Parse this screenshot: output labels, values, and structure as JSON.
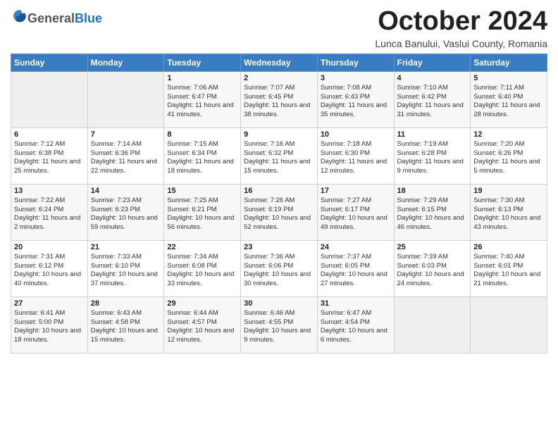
{
  "header": {
    "logo_general": "General",
    "logo_blue": "Blue",
    "month": "October 2024",
    "location": "Lunca Banului, Vaslui County, Romania"
  },
  "days_of_week": [
    "Sunday",
    "Monday",
    "Tuesday",
    "Wednesday",
    "Thursday",
    "Friday",
    "Saturday"
  ],
  "weeks": [
    [
      {
        "day": "",
        "content": ""
      },
      {
        "day": "",
        "content": ""
      },
      {
        "day": "1",
        "content": "Sunrise: 7:06 AM\nSunset: 6:47 PM\nDaylight: 11 hours and 41 minutes."
      },
      {
        "day": "2",
        "content": "Sunrise: 7:07 AM\nSunset: 6:45 PM\nDaylight: 11 hours and 38 minutes."
      },
      {
        "day": "3",
        "content": "Sunrise: 7:08 AM\nSunset: 6:43 PM\nDaylight: 11 hours and 35 minutes."
      },
      {
        "day": "4",
        "content": "Sunrise: 7:10 AM\nSunset: 6:42 PM\nDaylight: 11 hours and 31 minutes."
      },
      {
        "day": "5",
        "content": "Sunrise: 7:11 AM\nSunset: 6:40 PM\nDaylight: 11 hours and 28 minutes."
      }
    ],
    [
      {
        "day": "6",
        "content": "Sunrise: 7:12 AM\nSunset: 6:38 PM\nDaylight: 11 hours and 25 minutes."
      },
      {
        "day": "7",
        "content": "Sunrise: 7:14 AM\nSunset: 6:36 PM\nDaylight: 11 hours and 22 minutes."
      },
      {
        "day": "8",
        "content": "Sunrise: 7:15 AM\nSunset: 6:34 PM\nDaylight: 11 hours and 18 minutes."
      },
      {
        "day": "9",
        "content": "Sunrise: 7:16 AM\nSunset: 6:32 PM\nDaylight: 11 hours and 15 minutes."
      },
      {
        "day": "10",
        "content": "Sunrise: 7:18 AM\nSunset: 6:30 PM\nDaylight: 11 hours and 12 minutes."
      },
      {
        "day": "11",
        "content": "Sunrise: 7:19 AM\nSunset: 6:28 PM\nDaylight: 11 hours and 9 minutes."
      },
      {
        "day": "12",
        "content": "Sunrise: 7:20 AM\nSunset: 6:26 PM\nDaylight: 11 hours and 5 minutes."
      }
    ],
    [
      {
        "day": "13",
        "content": "Sunrise: 7:22 AM\nSunset: 6:24 PM\nDaylight: 11 hours and 2 minutes."
      },
      {
        "day": "14",
        "content": "Sunrise: 7:23 AM\nSunset: 6:23 PM\nDaylight: 10 hours and 59 minutes."
      },
      {
        "day": "15",
        "content": "Sunrise: 7:25 AM\nSunset: 6:21 PM\nDaylight: 10 hours and 56 minutes."
      },
      {
        "day": "16",
        "content": "Sunrise: 7:26 AM\nSunset: 6:19 PM\nDaylight: 10 hours and 52 minutes."
      },
      {
        "day": "17",
        "content": "Sunrise: 7:27 AM\nSunset: 6:17 PM\nDaylight: 10 hours and 49 minutes."
      },
      {
        "day": "18",
        "content": "Sunrise: 7:29 AM\nSunset: 6:15 PM\nDaylight: 10 hours and 46 minutes."
      },
      {
        "day": "19",
        "content": "Sunrise: 7:30 AM\nSunset: 6:13 PM\nDaylight: 10 hours and 43 minutes."
      }
    ],
    [
      {
        "day": "20",
        "content": "Sunrise: 7:31 AM\nSunset: 6:12 PM\nDaylight: 10 hours and 40 minutes."
      },
      {
        "day": "21",
        "content": "Sunrise: 7:33 AM\nSunset: 6:10 PM\nDaylight: 10 hours and 37 minutes."
      },
      {
        "day": "22",
        "content": "Sunrise: 7:34 AM\nSunset: 6:08 PM\nDaylight: 10 hours and 33 minutes."
      },
      {
        "day": "23",
        "content": "Sunrise: 7:36 AM\nSunset: 6:06 PM\nDaylight: 10 hours and 30 minutes."
      },
      {
        "day": "24",
        "content": "Sunrise: 7:37 AM\nSunset: 6:05 PM\nDaylight: 10 hours and 27 minutes."
      },
      {
        "day": "25",
        "content": "Sunrise: 7:39 AM\nSunset: 6:03 PM\nDaylight: 10 hours and 24 minutes."
      },
      {
        "day": "26",
        "content": "Sunrise: 7:40 AM\nSunset: 6:01 PM\nDaylight: 10 hours and 21 minutes."
      }
    ],
    [
      {
        "day": "27",
        "content": "Sunrise: 6:41 AM\nSunset: 5:00 PM\nDaylight: 10 hours and 18 minutes."
      },
      {
        "day": "28",
        "content": "Sunrise: 6:43 AM\nSunset: 4:58 PM\nDaylight: 10 hours and 15 minutes."
      },
      {
        "day": "29",
        "content": "Sunrise: 6:44 AM\nSunset: 4:57 PM\nDaylight: 10 hours and 12 minutes."
      },
      {
        "day": "30",
        "content": "Sunrise: 6:46 AM\nSunset: 4:55 PM\nDaylight: 10 hours and 9 minutes."
      },
      {
        "day": "31",
        "content": "Sunrise: 6:47 AM\nSunset: 4:54 PM\nDaylight: 10 hours and 6 minutes."
      },
      {
        "day": "",
        "content": ""
      },
      {
        "day": "",
        "content": ""
      }
    ]
  ]
}
